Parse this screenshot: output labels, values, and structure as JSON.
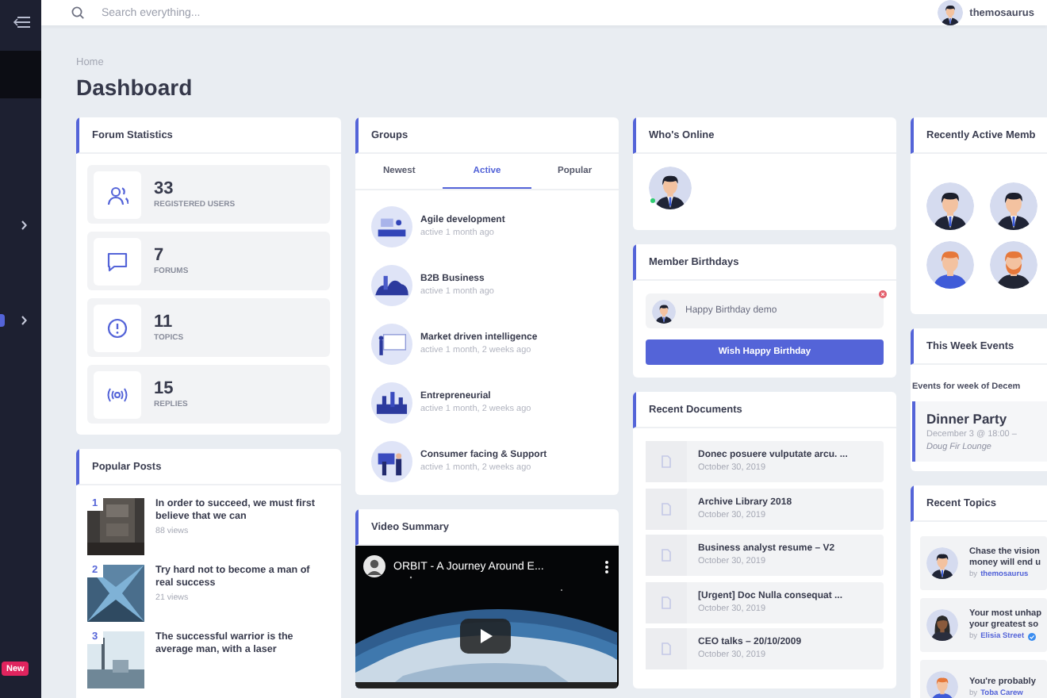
{
  "sidebar": {
    "items": [
      {
        "selected": true,
        "submenu": false,
        "marker": false
      },
      {
        "selected": false,
        "submenu": true,
        "marker": false
      },
      {
        "selected": false,
        "submenu": true,
        "marker": true
      }
    ],
    "badge": "New"
  },
  "topbar": {
    "search": {
      "placeholder": "Search everything..."
    },
    "user": {
      "name": "themosaurus"
    }
  },
  "breadcrumb": "Home",
  "page_title": "Dashboard",
  "columns": [
    [
      {
        "kind": "stats",
        "title": "Forum Statistics",
        "items": [
          {
            "kind": "users",
            "value": "33",
            "label": "REGISTERED USERS"
          },
          {
            "kind": "forums",
            "value": "7",
            "label": "FORUMS"
          },
          {
            "kind": "topics",
            "value": "11",
            "label": "TOPICS"
          },
          {
            "kind": "replies",
            "value": "15",
            "label": "REPLIES"
          }
        ]
      },
      {
        "kind": "posts",
        "title": "Popular Posts",
        "items": [
          {
            "rank": "1",
            "title": "In order to succeed, we must first believe that we can",
            "views": "88 views"
          },
          {
            "rank": "2",
            "title": "Try hard not to become a man of real success",
            "views": "21 views"
          },
          {
            "rank": "3",
            "title": "The successful warrior is the average man, with a laser"
          }
        ]
      }
    ],
    [
      {
        "kind": "groups",
        "title": "Groups",
        "tabs": [
          {
            "label": "Newest",
            "selected": false
          },
          {
            "label": "Active",
            "selected": true
          },
          {
            "label": "Popular",
            "selected": false
          }
        ],
        "items": [
          {
            "name": "Agile development",
            "activity": "active 1 month ago"
          },
          {
            "name": "B2B Business",
            "activity": "active 1 month ago"
          },
          {
            "name": "Market driven intelligence",
            "activity": "active 1 month, 2 weeks ago"
          },
          {
            "name": "Entrepreneurial",
            "activity": "active 1 month, 2 weeks ago"
          },
          {
            "name": "Consumer facing & Support",
            "activity": "active 1 month, 2 weeks ago"
          }
        ]
      },
      {
        "kind": "video",
        "title": "Video Summary",
        "video_title": "ORBIT - A Journey Around E..."
      }
    ],
    [
      {
        "kind": "online",
        "title": "Who's Online",
        "users": [
          {
            "online": true
          }
        ]
      },
      {
        "kind": "birthdays",
        "title": "Member Birthdays",
        "message": "Happy Birthday demo",
        "button": "Wish Happy Birthday"
      },
      {
        "kind": "documents",
        "title": "Recent Documents",
        "items": [
          {
            "title": "Donec posuere vulputate arcu. ...",
            "date": "October 30, 2019"
          },
          {
            "title": "Archive Library 2018",
            "date": "October 30, 2019"
          },
          {
            "title": "Business analyst resume – V2",
            "date": "October 30, 2019"
          },
          {
            "title": "[Urgent] Doc Nulla consequat ...",
            "date": "October 30, 2019"
          },
          {
            "title": "CEO talks – 20/10/2009",
            "date": "October 30, 2019"
          }
        ]
      }
    ],
    [
      {
        "kind": "members",
        "title": "Recently Active Memb"
      },
      {
        "kind": "events",
        "title": "This Week Events",
        "intro": "Events for week of Decem",
        "event": {
          "title": "Dinner Party",
          "time": "December 3 @ 18:00 –",
          "venue": "Doug Fir Lounge"
        }
      },
      {
        "kind": "topics",
        "title": "Recent Topics",
        "items": [
          {
            "lines": [
              "Chase the vision",
              "money will end u"
            ],
            "by": "by",
            "author": "themosaurus",
            "verified": false
          },
          {
            "lines": [
              "Your most unhap",
              "your greatest so"
            ],
            "by": "by",
            "author": "Elisia Street",
            "verified": true
          },
          {
            "lines": [
              "You're probably"
            ],
            "by": "by",
            "author": "Toba Carew",
            "verified": false
          }
        ]
      }
    ]
  ]
}
